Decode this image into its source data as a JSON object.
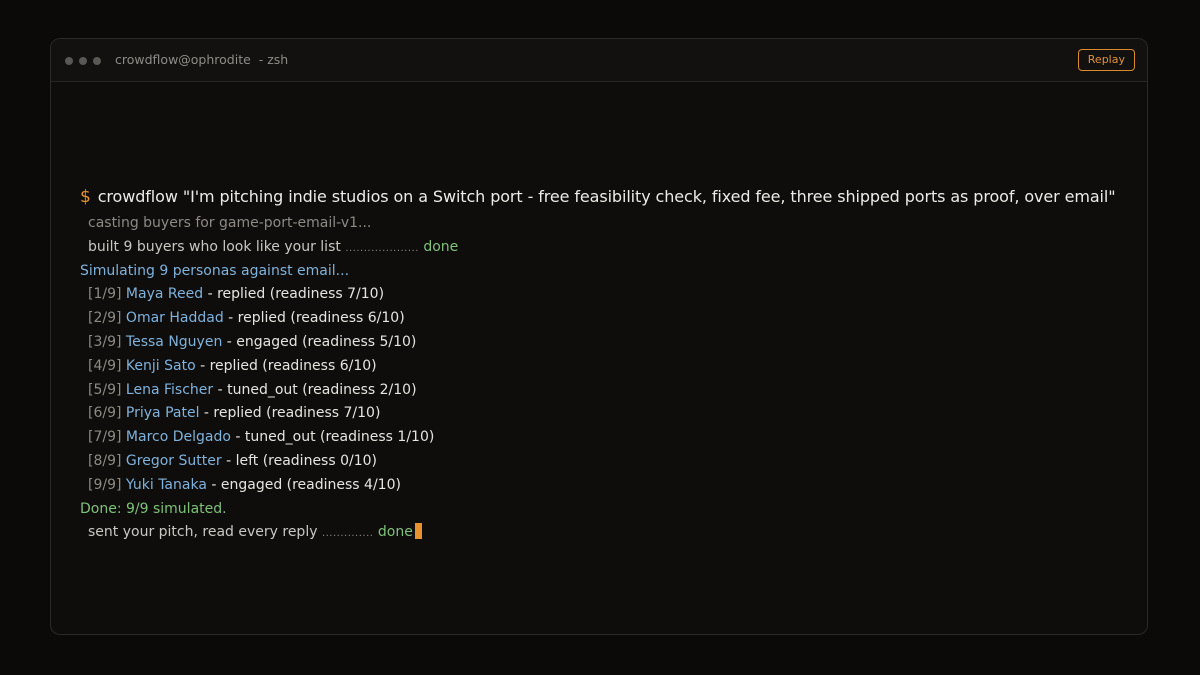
{
  "window": {
    "title": "crowdflow@ophrodite  - zsh",
    "replay_label": "Replay"
  },
  "terminal": {
    "prompt": "$",
    "command": "crowdflow",
    "argument": "\"I'm pitching indie studios on a Switch port - free feasibility check, fixed fee, three shipped ports as proof, over email\"",
    "casting_line": "casting buyers for game-port-email-v1...",
    "built_text": "built 9 buyers who look like your list",
    "built_leader": "....................",
    "built_status": "done",
    "simulating_line": "Simulating 9 personas against email...",
    "personas": [
      {
        "index": "[1/9]",
        "name": "Maya Reed",
        "result": "- replied (readiness 7/10)"
      },
      {
        "index": "[2/9]",
        "name": "Omar Haddad",
        "result": "- replied (readiness 6/10)"
      },
      {
        "index": "[3/9]",
        "name": "Tessa Nguyen",
        "result": "- engaged (readiness 5/10)"
      },
      {
        "index": "[4/9]",
        "name": "Kenji Sato",
        "result": "- replied (readiness 6/10)"
      },
      {
        "index": "[5/9]",
        "name": "Lena Fischer",
        "result": "- tuned_out (readiness 2/10)"
      },
      {
        "index": "[6/9]",
        "name": "Priya Patel",
        "result": "- replied (readiness 7/10)"
      },
      {
        "index": "[7/9]",
        "name": "Marco Delgado",
        "result": "- tuned_out (readiness 1/10)"
      },
      {
        "index": "[8/9]",
        "name": "Gregor Sutter",
        "result": "- left (readiness 0/10)"
      },
      {
        "index": "[9/9]",
        "name": "Yuki Tanaka",
        "result": "- engaged (readiness 4/10)"
      }
    ],
    "done_line": "Done: 9/9 simulated.",
    "sent_text": "sent your pitch, read every reply",
    "sent_leader": "..............",
    "sent_status": "done"
  },
  "colors": {
    "accent_orange": "#e8922f",
    "persona_blue": "#7fb2dc",
    "success_green": "#7fc17a"
  }
}
